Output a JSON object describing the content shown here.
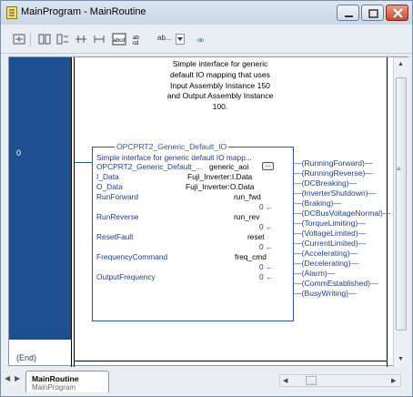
{
  "window": {
    "title": "MainProgram - MainRoutine"
  },
  "toolbar": {
    "dropdown_label": "ab..."
  },
  "rung": {
    "number": "0",
    "end_label": "(End)",
    "description": "Simple interface for generic default IO mapping that uses Input Assembly Instance 150 and Output Assembly Instance 100."
  },
  "aoi": {
    "title": "OPCPRT2_Generic_Default_IO",
    "description": "Simple interface for generic default IO mapp...",
    "params": [
      {
        "label": "OPCPRT2_Generic_Default_...",
        "value": "generic_aoi"
      },
      {
        "label": "I_Data",
        "value": "Fuji_Inverter:I.Data"
      },
      {
        "label": "O_Data",
        "value": "Fuji_Inverter:O.Data"
      },
      {
        "label": "RunForward",
        "value": "run_fwd",
        "sub": "0 ←"
      },
      {
        "label": "RunReverse",
        "value": "run_rev",
        "sub": "0 ←"
      },
      {
        "label": "ResetFault",
        "value": "reset",
        "sub": "0 ←"
      },
      {
        "label": "FrequencyCommand",
        "value": "freq_cmd",
        "sub": "0 ←"
      },
      {
        "label": "OutputFrequency",
        "value": "0 ←"
      }
    ],
    "coils": [
      "(RunningForward)—",
      "(RunningReverse)—",
      "(DCBreaking)—",
      "(InverterShutdown)—",
      "(Braking)—",
      "(DCBusVoltageNormal)—",
      "(TorqueLimiting)—",
      "(VoltageLimited)—",
      "(CurrentLimited)—",
      "(Accelerating)—",
      "(Decelerating)—",
      "(Alarm)—",
      "(CommEstablished)—",
      "(BusyWriting)—"
    ]
  },
  "tabs": [
    {
      "label": "MainRoutine",
      "sublabel": "MainProgram"
    }
  ]
}
